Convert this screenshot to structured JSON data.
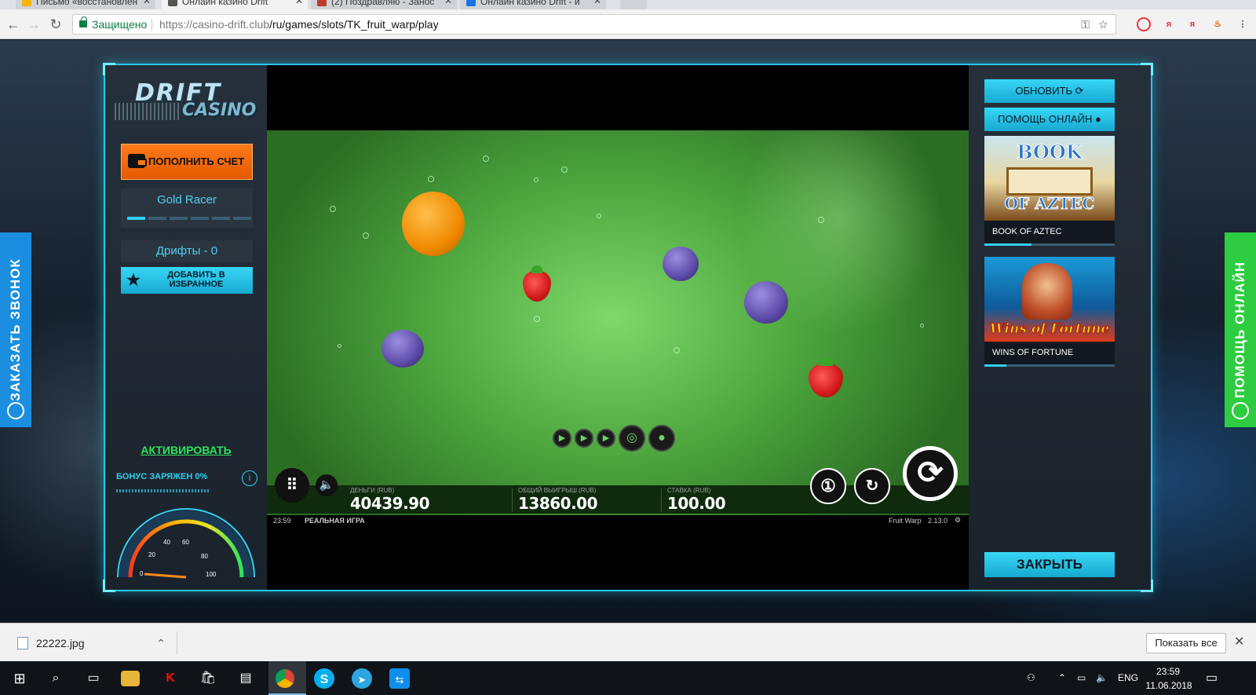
{
  "browser": {
    "tabs": [
      {
        "title": "Письмо «восстановлен",
        "color": "#f4b400",
        "active": false
      },
      {
        "title": "Онлайн казино Drift",
        "color": "#555555",
        "active": true
      },
      {
        "title": "(2) Поздравляю - Занос",
        "color": "#c0392b",
        "active": false
      },
      {
        "title": "Онлайн казино Drift - и",
        "color": "#1a73e8",
        "active": false
      }
    ],
    "secure_label": "Защищено",
    "url_host": "https://casino-drift.club",
    "url_path": "/ru/games/slots/TK_fruit_warp/play"
  },
  "side_tabs": {
    "left": "ЗАКАЗАТЬ ЗВОНОК",
    "right": "ПОМОЩЬ ОНЛАЙН"
  },
  "left_panel": {
    "logo_top": "DRIFT",
    "logo_bottom": "CASINO",
    "deposit_label": "ПОПОЛНИТЬ СЧЕТ",
    "level_name": "Gold Racer",
    "level_progress": 0.15,
    "drifts_label": "Дрифты - 0",
    "favorite_label_1": "ДОБАВИТЬ В",
    "favorite_label_2": "ИЗБРАННОЕ",
    "activate_label": "АКТИВИРОВАТЬ",
    "bonus_label": "БОНУС ЗАРЯЖЕН 0%",
    "bonus_percent": 0,
    "gauge_ticks": [
      "0",
      "20",
      "40",
      "60",
      "80",
      "100"
    ]
  },
  "game": {
    "hud": {
      "money_label": "ДЕНЬГИ (RUB)",
      "money_value": "40439.90",
      "win_label": "ОБЩИЙ ВЫИГРЫШ (RUB)",
      "win_value": "13860.00",
      "bet_label": "СТАВКА (RUB)",
      "bet_value": "100.00"
    },
    "status": {
      "time": "23:59",
      "mode": "РЕАЛЬНАЯ ИГРА",
      "game_name": "Fruit Warp",
      "version": "2.13.0"
    }
  },
  "right_panel": {
    "refresh_label": "ОБНОВИТЬ",
    "help_label": "ПОМОЩЬ ОНЛАЙН",
    "games": [
      {
        "title": "BOOK OF AZTEC",
        "art_top": "BOOK",
        "art_bottom": "OF AZTEC"
      },
      {
        "title": "WINS OF FORTUNE",
        "art_top": "",
        "art_bottom": "Wins of Fortune"
      }
    ],
    "close_label": "ЗАКРЫТЬ"
  },
  "download_bar": {
    "file_name": "22222.jpg",
    "show_all_label": "Показать все"
  },
  "taskbar": {
    "lang": "ENG",
    "time": "23:59",
    "date": "11.06.2018"
  }
}
